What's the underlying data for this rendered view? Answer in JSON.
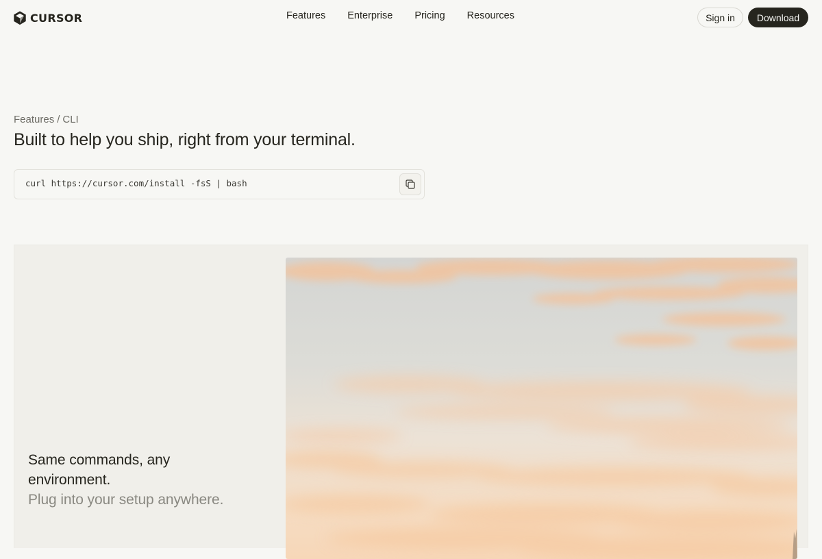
{
  "header": {
    "logo_text": "CURSOR",
    "logo_icon": "cube-logo-icon",
    "nav": [
      {
        "label": "Features"
      },
      {
        "label": "Enterprise"
      },
      {
        "label": "Pricing"
      },
      {
        "label": "Resources"
      }
    ],
    "signin_label": "Sign in",
    "download_label": "Download"
  },
  "hero": {
    "breadcrumb": {
      "section": "Features",
      "separator": "/",
      "current": "CLI"
    },
    "title": "Built to help you ship, right from your terminal."
  },
  "install": {
    "command": "curl https://cursor.com/install -fsS | bash",
    "copy_icon": "copy-icon"
  },
  "feature": {
    "heading": "Same commands, any environment.",
    "subheading": "Plug into your setup anywhere."
  },
  "colors": {
    "background": "#f7f7f4",
    "text": "#26251e",
    "muted_text": "#8a8982",
    "panel": "#f0efea",
    "button_dark": "#26251e"
  }
}
